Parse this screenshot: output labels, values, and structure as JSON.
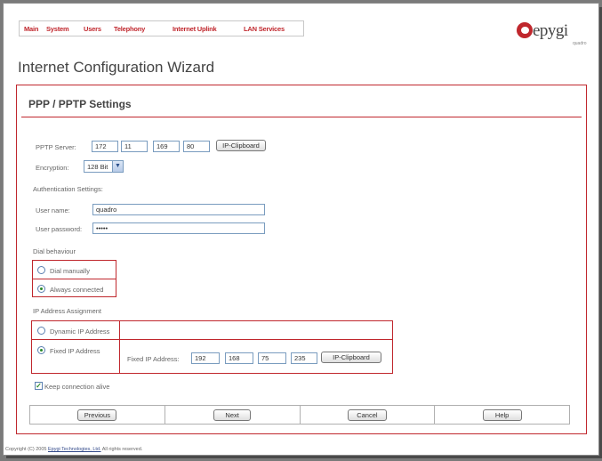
{
  "nav": {
    "items": [
      {
        "label": "Main"
      },
      {
        "label": "System"
      },
      {
        "label": "Users"
      },
      {
        "label": "Telephony"
      },
      {
        "label": "Internet Uplink"
      },
      {
        "label": "LAN Services"
      }
    ]
  },
  "logo": {
    "text": "epygi",
    "sub": "quadro"
  },
  "page": {
    "title": "Internet Configuration Wizard"
  },
  "section": {
    "title": "PPP / PPTP Settings"
  },
  "pptp": {
    "label": "PPTP Server:",
    "octets": [
      "172",
      "11",
      "169",
      "80"
    ],
    "clipboard_label": "IP-Clipboard"
  },
  "encryption": {
    "label": "Encryption:",
    "value": "128 Bit"
  },
  "auth": {
    "heading": "Authentication Settings:",
    "username_label": "User name:",
    "username_value": "quadro",
    "password_label": "User password:",
    "password_value": "•••••"
  },
  "dial": {
    "heading": "Dial behaviour",
    "option_manual": "Dial manually",
    "option_always": "Always connected",
    "selected": "Always connected"
  },
  "ip_assign": {
    "heading": "IP Address Assignment",
    "option_dynamic": "Dynamic IP Address",
    "option_fixed": "Fixed IP Address",
    "selected": "Fixed IP Address",
    "fixed_label": "Fixed IP Address:",
    "octets": [
      "192",
      "168",
      "75",
      "235"
    ],
    "clipboard_label": "IP-Clipboard"
  },
  "keepalive": {
    "label": "Keep connection alive",
    "checked": true
  },
  "footer": {
    "previous": "Previous",
    "next": "Next",
    "cancel": "Cancel",
    "help": "Help"
  },
  "copyright": {
    "prefix": "Copyright (C) 2005 ",
    "company": "Epygi Technologies, Ltd.",
    "suffix": " All rights reserved."
  },
  "colors": {
    "accent": "#c0272d",
    "field_border": "#7a9cbf"
  }
}
